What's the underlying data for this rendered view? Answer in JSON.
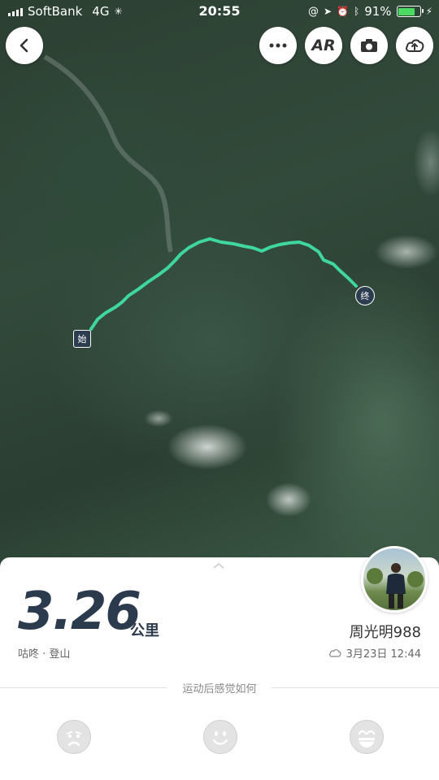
{
  "status_bar": {
    "carrier": "SoftBank",
    "network": "4G",
    "time": "20:55",
    "battery_percent": "91%",
    "battery_level": 0.91
  },
  "toolbar": {
    "ar_label": "AR"
  },
  "route": {
    "start_label": "始",
    "end_label": "终",
    "color": "#3fd6a0"
  },
  "summary": {
    "distance": "3.26",
    "unit": "公里",
    "sport": "咕咚 · 登山",
    "username": "周光明988",
    "date_time": "3月23日 12:44",
    "feeling_prompt": "运动后感觉如何"
  },
  "colors": {
    "accent_text": "#2b3a4d",
    "battery_green": "#4cd964"
  }
}
